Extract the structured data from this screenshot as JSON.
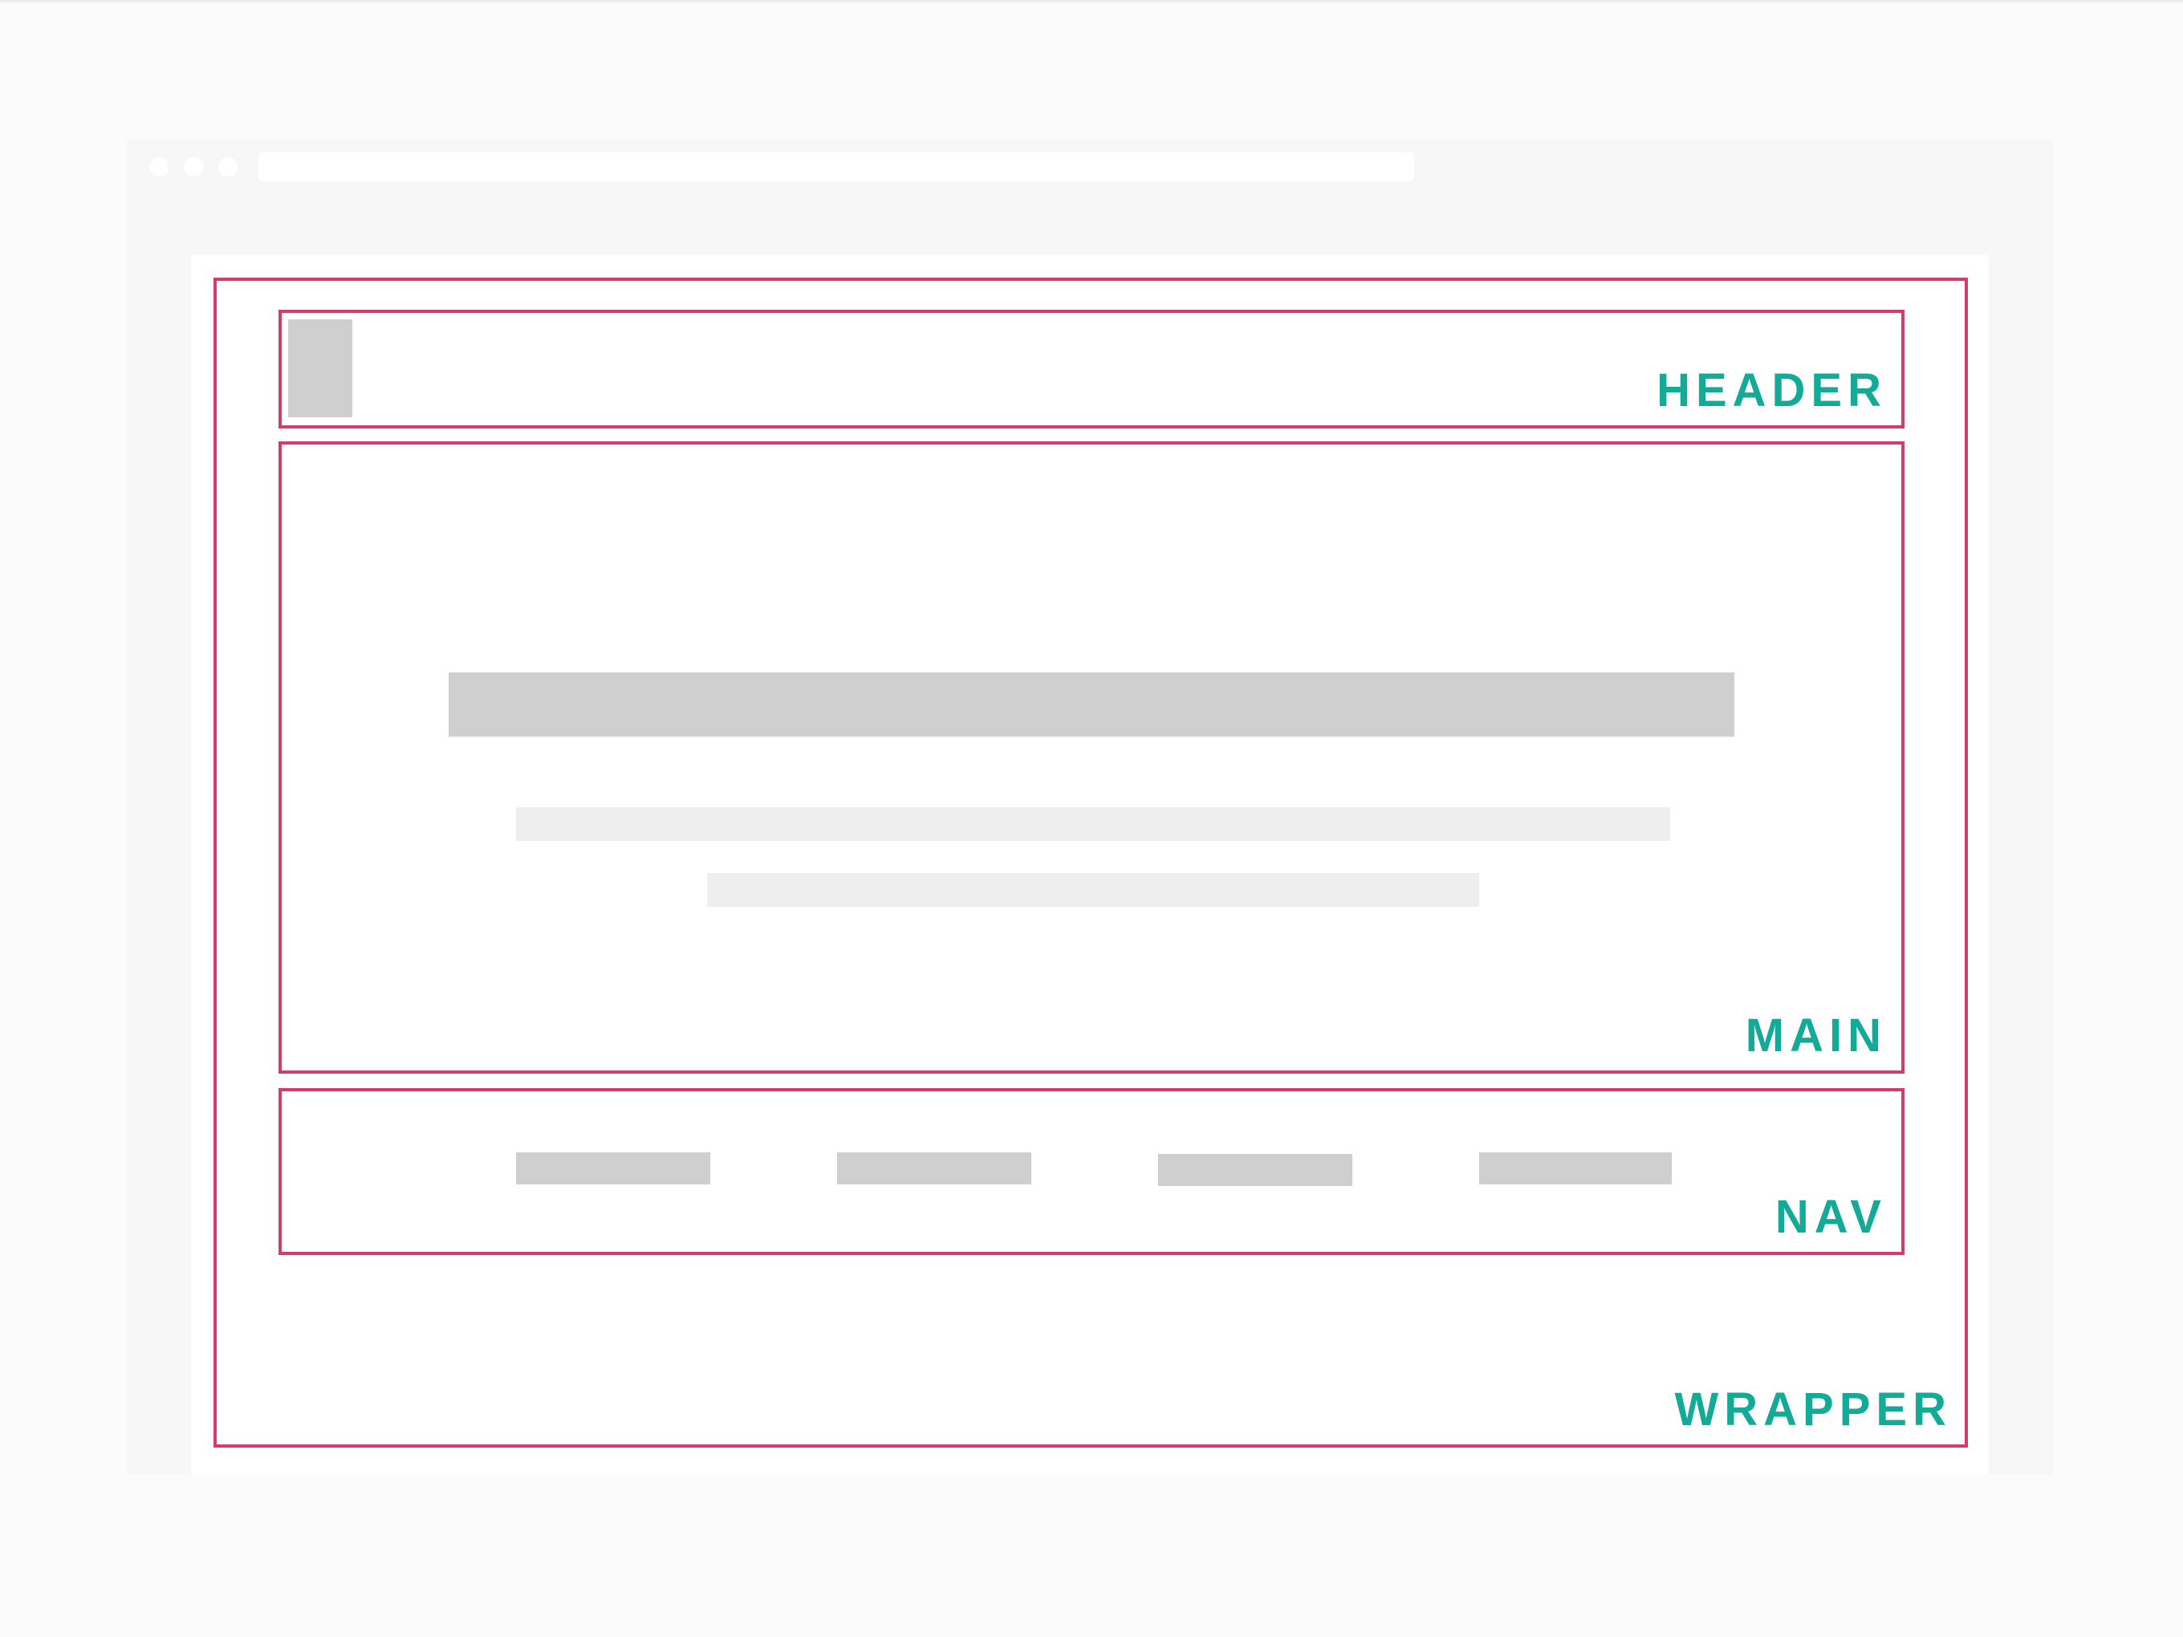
{
  "labels": {
    "wrapper": "WRAPPER",
    "header": "HEADER",
    "main": "MAIN",
    "nav": "NAV"
  },
  "colors": {
    "region_border": "#d43d6a",
    "label_text": "#13ab97",
    "placeholder_block": "#cfcfcf",
    "placeholder_line": "#eeeeee",
    "browser_chrome": "#f7f7f7"
  },
  "nav": {
    "item_count": 4
  }
}
